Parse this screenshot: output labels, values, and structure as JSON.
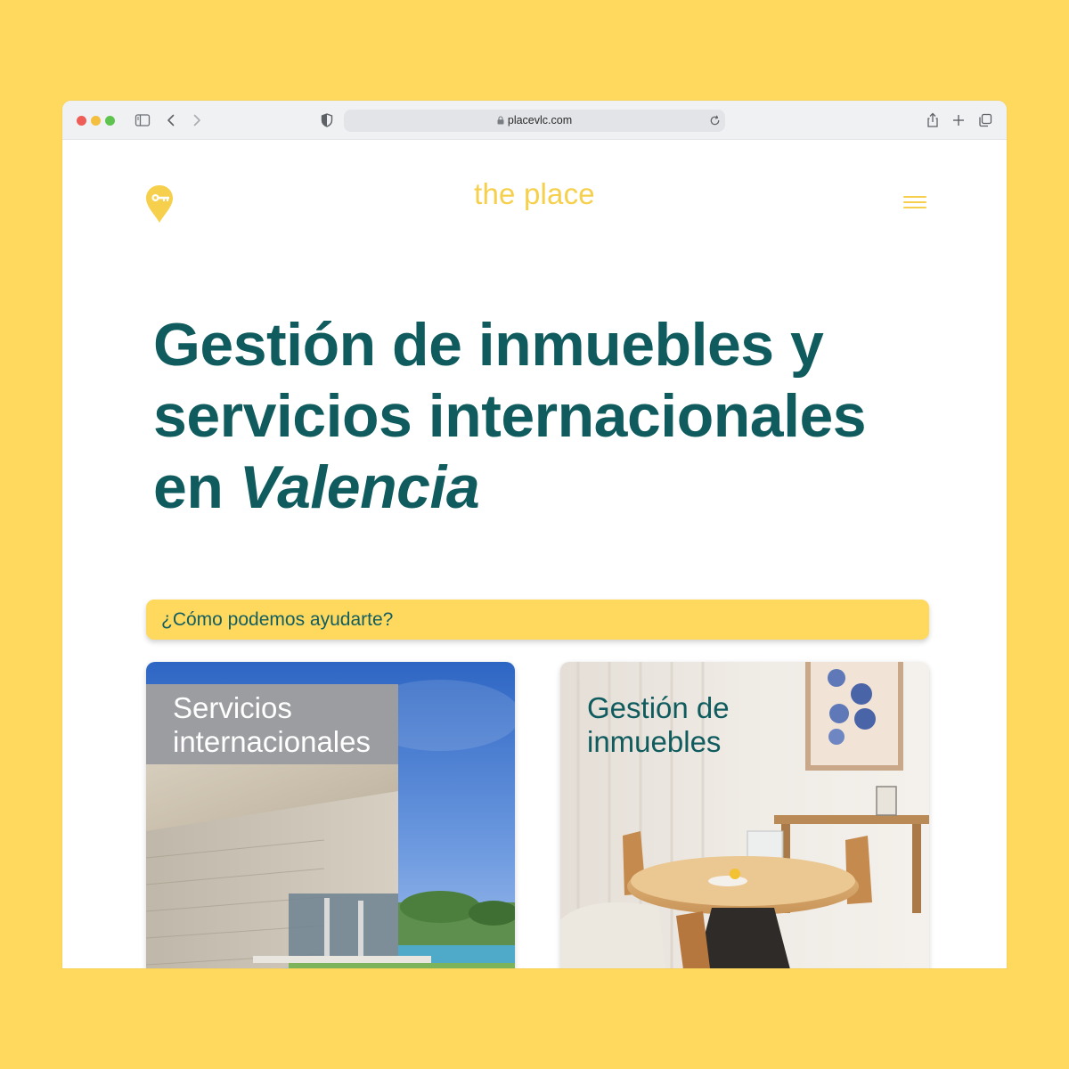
{
  "browser": {
    "url": "placevlc.com"
  },
  "header": {
    "brand": "the place",
    "logo_icon": "location-pin-key-icon",
    "menu_icon": "hamburger-menu-icon"
  },
  "hero": {
    "line1": "Gestión de inmuebles y",
    "line2": "servicios internacionales",
    "line3_prefix": "en ",
    "line3_accent": "Valencia"
  },
  "help": {
    "label": "¿Cómo podemos ayudarte?"
  },
  "cards": [
    {
      "title_line1": "Servicios",
      "title_line2": "internacionales",
      "image": "modern-villa-photo"
    },
    {
      "title_line1": "Gestión de",
      "title_line2": "inmuebles",
      "image": "dining-room-photo"
    }
  ],
  "colors": {
    "background": "#FFD95E",
    "brand_yellow": "#F6D04C",
    "heading_teal": "#0F5B5E"
  }
}
